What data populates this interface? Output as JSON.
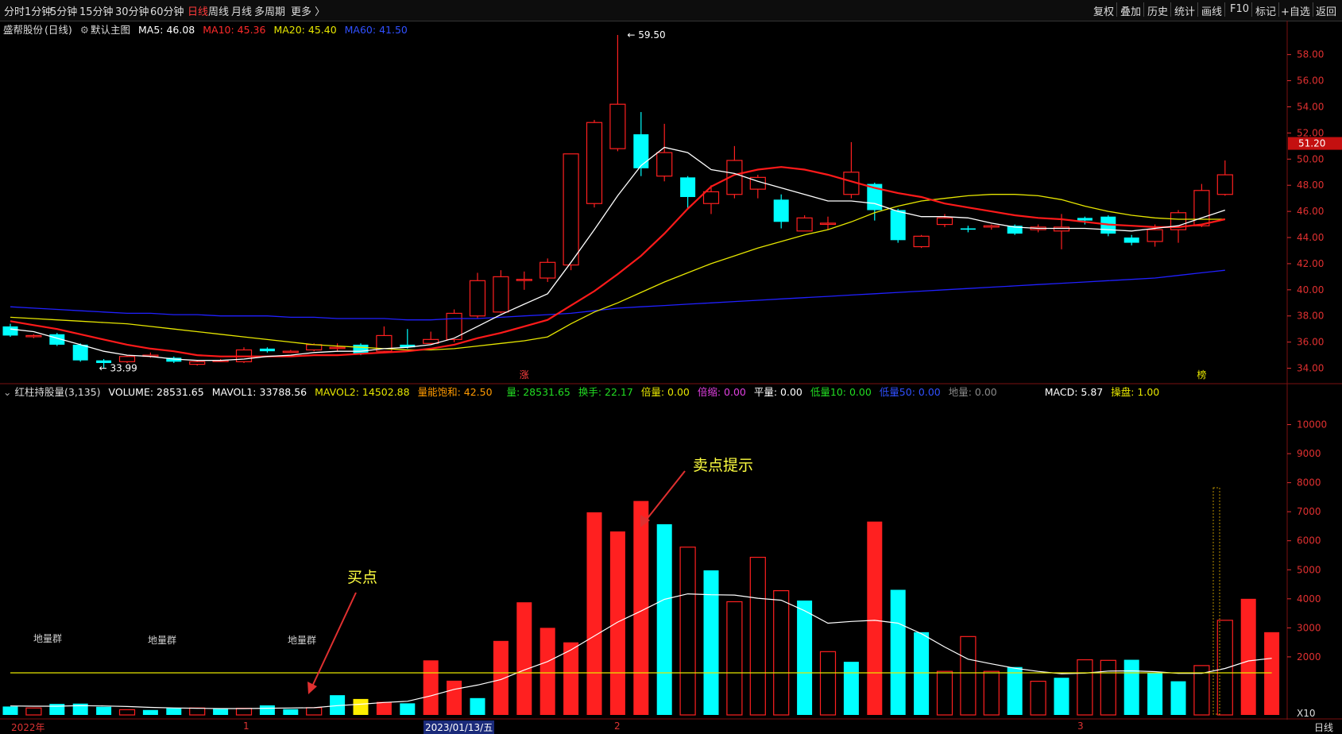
{
  "toolbar": {
    "left_tabs": [
      "分时",
      "1分钟",
      "5分钟",
      "15分钟",
      "30分钟",
      "60分钟",
      "日线",
      "周线",
      "月线",
      "多周期",
      "更多 〉"
    ],
    "active_tab": "日线",
    "right_buttons": [
      "复权",
      "叠加",
      "历史",
      "统计",
      "画线",
      "F10",
      "标记",
      "+自选",
      "返回"
    ]
  },
  "main_legend": {
    "stock": "盛帮股份",
    "period": "(日线)",
    "main_chart": "默认主图",
    "ma5": "MA5: 46.08",
    "ma10": "MA10: 45.36",
    "ma20": "MA20: 45.40",
    "ma60": "MA60: 41.50"
  },
  "volume_legend": {
    "name": "红柱持股量(3,135)",
    "volume": "VOLUME: 28531.65",
    "mavol1": "MAVOL1: 33788.56",
    "mavol2": "MAVOL2: 14502.88",
    "satur": "量能饱和: 42.50",
    "liang": "量: 28531.65",
    "huanshou": "换手: 22.17",
    "beiliang": "倍量: 0.00",
    "beisuo": "倍缩: 0.00",
    "pingliang": "平量: 0.00",
    "diliang10": "低量10: 0.00",
    "diliang50": "低量50: 0.00",
    "diliang": "地量: 0.00",
    "macd": "MACD: 5.87",
    "caopan": "操盘: 1.00"
  },
  "colors": {
    "up": "#ff2020",
    "down": "#00ffff",
    "ma5": "#ffffff",
    "ma10": "#ff1a1a",
    "ma20": "#e6e600",
    "ma60": "#2020ff",
    "axis": "#e03030",
    "annotation": "#ffff40"
  },
  "annotations": {
    "high": "59.50",
    "low": "33.99",
    "buy": "买点",
    "sell": "卖点提示",
    "zhang": "涨",
    "bang": "榜",
    "diliangqun": "地量群",
    "x10": "X10",
    "current_price": "51.20"
  },
  "bottom": {
    "dates": [
      "2022年",
      "1",
      "2023/01/13/五",
      "2",
      "3"
    ],
    "period": "日线"
  },
  "chart_data": [
    {
      "type": "candlestick",
      "title": "盛帮股份 (日线)",
      "ylim": [
        33.0,
        59.5
      ],
      "yticks": [
        34,
        36,
        38,
        40,
        42,
        44,
        46,
        48,
        50,
        52,
        54,
        56,
        58
      ],
      "candles": [
        {
          "o": 37.2,
          "h": 37.4,
          "l": 36.4,
          "c": 36.5
        },
        {
          "o": 36.5,
          "h": 36.6,
          "l": 36.3,
          "c": 36.5
        },
        {
          "o": 36.6,
          "h": 36.7,
          "l": 35.7,
          "c": 35.8
        },
        {
          "o": 35.8,
          "h": 35.9,
          "l": 34.5,
          "c": 34.6
        },
        {
          "o": 34.6,
          "h": 34.7,
          "l": 33.99,
          "c": 34.4
        },
        {
          "o": 34.5,
          "h": 35.0,
          "l": 34.4,
          "c": 34.9
        },
        {
          "o": 35.0,
          "h": 35.2,
          "l": 34.8,
          "c": 35.0
        },
        {
          "o": 34.8,
          "h": 34.9,
          "l": 34.4,
          "c": 34.5
        },
        {
          "o": 34.3,
          "h": 34.6,
          "l": 34.2,
          "c": 34.5
        },
        {
          "o": 34.6,
          "h": 34.7,
          "l": 34.5,
          "c": 34.6
        },
        {
          "o": 34.5,
          "h": 35.6,
          "l": 34.4,
          "c": 35.4
        },
        {
          "o": 35.5,
          "h": 35.6,
          "l": 35.2,
          "c": 35.3
        },
        {
          "o": 35.3,
          "h": 35.4,
          "l": 35.2,
          "c": 35.3
        },
        {
          "o": 35.4,
          "h": 35.9,
          "l": 35.3,
          "c": 35.8
        },
        {
          "o": 35.6,
          "h": 35.9,
          "l": 35.3,
          "c": 35.6
        },
        {
          "o": 35.8,
          "h": 35.9,
          "l": 35.0,
          "c": 35.1
        },
        {
          "o": 35.3,
          "h": 37.2,
          "l": 35.2,
          "c": 36.5
        },
        {
          "o": 35.8,
          "h": 37.0,
          "l": 35.5,
          "c": 35.6
        },
        {
          "o": 35.9,
          "h": 36.8,
          "l": 35.8,
          "c": 36.2
        },
        {
          "o": 36.2,
          "h": 38.5,
          "l": 36.0,
          "c": 38.2
        },
        {
          "o": 38.0,
          "h": 41.3,
          "l": 37.8,
          "c": 40.7
        },
        {
          "o": 38.3,
          "h": 41.5,
          "l": 38.2,
          "c": 41.0
        },
        {
          "o": 40.8,
          "h": 41.4,
          "l": 40.0,
          "c": 40.8
        },
        {
          "o": 40.9,
          "h": 42.4,
          "l": 40.6,
          "c": 42.1
        },
        {
          "o": 41.9,
          "h": 50.4,
          "l": 41.5,
          "c": 50.4
        },
        {
          "o": 46.6,
          "h": 53.0,
          "l": 46.3,
          "c": 52.8
        },
        {
          "o": 50.8,
          "h": 59.5,
          "l": 50.6,
          "c": 54.2
        },
        {
          "o": 51.9,
          "h": 53.6,
          "l": 48.7,
          "c": 49.3
        },
        {
          "o": 48.7,
          "h": 52.7,
          "l": 48.3,
          "c": 50.5
        },
        {
          "o": 48.6,
          "h": 48.7,
          "l": 46.2,
          "c": 47.1
        },
        {
          "o": 46.6,
          "h": 48.0,
          "l": 45.8,
          "c": 47.5
        },
        {
          "o": 47.3,
          "h": 51.0,
          "l": 47.0,
          "c": 49.9
        },
        {
          "o": 47.7,
          "h": 48.8,
          "l": 47.0,
          "c": 48.6
        },
        {
          "o": 46.9,
          "h": 47.3,
          "l": 44.7,
          "c": 45.2
        },
        {
          "o": 44.5,
          "h": 45.7,
          "l": 44.5,
          "c": 45.5
        },
        {
          "o": 45.1,
          "h": 45.6,
          "l": 44.6,
          "c": 45.1
        },
        {
          "o": 47.3,
          "h": 51.3,
          "l": 47.0,
          "c": 49.0
        },
        {
          "o": 48.1,
          "h": 48.2,
          "l": 45.3,
          "c": 46.1
        },
        {
          "o": 46.1,
          "h": 46.2,
          "l": 43.6,
          "c": 43.8
        },
        {
          "o": 43.3,
          "h": 44.2,
          "l": 43.2,
          "c": 44.1
        },
        {
          "o": 45.0,
          "h": 45.8,
          "l": 44.8,
          "c": 45.5
        },
        {
          "o": 44.7,
          "h": 44.9,
          "l": 44.4,
          "c": 44.6
        },
        {
          "o": 44.8,
          "h": 45.0,
          "l": 44.6,
          "c": 44.9
        },
        {
          "o": 44.9,
          "h": 45.0,
          "l": 44.2,
          "c": 44.3
        },
        {
          "o": 44.6,
          "h": 45.0,
          "l": 44.4,
          "c": 44.8
        },
        {
          "o": 44.5,
          "h": 45.8,
          "l": 43.1,
          "c": 44.8
        },
        {
          "o": 45.5,
          "h": 45.6,
          "l": 45.0,
          "c": 45.3
        },
        {
          "o": 45.6,
          "h": 45.7,
          "l": 44.1,
          "c": 44.3
        },
        {
          "o": 44.0,
          "h": 44.2,
          "l": 43.4,
          "c": 43.6
        },
        {
          "o": 43.7,
          "h": 45.0,
          "l": 43.3,
          "c": 44.6
        },
        {
          "o": 44.6,
          "h": 46.1,
          "l": 43.6,
          "c": 45.9
        },
        {
          "o": 44.9,
          "h": 48.1,
          "l": 44.8,
          "c": 47.6
        },
        {
          "o": 47.3,
          "h": 49.9,
          "l": 47.2,
          "c": 48.8
        }
      ],
      "ma5": [
        37.0,
        36.8,
        36.3,
        35.8,
        35.3,
        35.0,
        34.9,
        34.7,
        34.6,
        34.6,
        34.7,
        34.9,
        35.0,
        35.2,
        35.3,
        35.3,
        35.5,
        35.6,
        35.8,
        36.3,
        37.2,
        38.1,
        38.9,
        39.7,
        42.1,
        44.6,
        47.2,
        49.5,
        50.9,
        50.5,
        49.2,
        48.9,
        48.3,
        47.8,
        47.3,
        46.8,
        46.8,
        46.6,
        46.0,
        45.6,
        45.6,
        45.5,
        45.1,
        44.8,
        44.7,
        44.7,
        44.7,
        44.6,
        44.5,
        44.7,
        44.9,
        45.5,
        46.1
      ],
      "ma10": [
        37.6,
        37.3,
        37.0,
        36.6,
        36.2,
        35.8,
        35.5,
        35.3,
        35.0,
        34.9,
        34.9,
        34.9,
        34.9,
        35.0,
        35.0,
        35.1,
        35.2,
        35.3,
        35.5,
        35.8,
        36.3,
        36.7,
        37.2,
        37.7,
        38.8,
        39.9,
        41.2,
        42.6,
        44.3,
        46.2,
        47.9,
        48.8,
        49.2,
        49.4,
        49.2,
        48.8,
        48.3,
        47.8,
        47.4,
        47.1,
        46.6,
        46.3,
        46.0,
        45.7,
        45.5,
        45.4,
        45.2,
        45.0,
        44.9,
        44.8,
        44.8,
        45.0,
        45.4
      ],
      "ma20": [
        37.9,
        37.8,
        37.7,
        37.6,
        37.5,
        37.4,
        37.2,
        37.0,
        36.8,
        36.6,
        36.4,
        36.2,
        36.0,
        35.8,
        35.7,
        35.6,
        35.5,
        35.4,
        35.4,
        35.5,
        35.7,
        35.9,
        36.1,
        36.4,
        37.4,
        38.3,
        39.0,
        39.8,
        40.6,
        41.3,
        42.0,
        42.6,
        43.2,
        43.7,
        44.2,
        44.6,
        45.2,
        45.9,
        46.4,
        46.8,
        47.0,
        47.2,
        47.3,
        47.3,
        47.2,
        46.9,
        46.4,
        46.0,
        45.7,
        45.5,
        45.4,
        45.4,
        45.4
      ],
      "ma60": [
        38.7,
        38.6,
        38.5,
        38.4,
        38.3,
        38.2,
        38.2,
        38.1,
        38.1,
        38.0,
        38.0,
        38.0,
        37.9,
        37.9,
        37.8,
        37.8,
        37.8,
        37.7,
        37.7,
        37.8,
        37.8,
        37.9,
        38.0,
        38.1,
        38.2,
        38.4,
        38.6,
        38.7,
        38.8,
        38.9,
        39.0,
        39.1,
        39.2,
        39.3,
        39.4,
        39.5,
        39.6,
        39.7,
        39.8,
        39.9,
        40.0,
        40.1,
        40.2,
        40.3,
        40.4,
        40.5,
        40.6,
        40.7,
        40.8,
        40.9,
        41.1,
        41.3,
        41.5
      ]
    },
    {
      "type": "bar",
      "title": "红柱持股量(3,135)",
      "ylim": [
        0,
        11000
      ],
      "yticks": [
        2000,
        3000,
        4000,
        5000,
        6000,
        7000,
        8000,
        9000,
        10000
      ],
      "volume": [
        290,
        240,
        380,
        390,
        280,
        180,
        170,
        230,
        240,
        220,
        230,
        330,
        200,
        250,
        680,
        550,
        450,
        400,
        1880,
        1180,
        580,
        2550,
        3880,
        3000,
        2500,
        6980,
        6320,
        7370,
        6570,
        5780,
        4980,
        3900,
        5430,
        4280,
        3940,
        2180,
        1830,
        6660,
        4310,
        2850,
        1500,
        2700,
        1500,
        1650,
        1160,
        1280,
        1900,
        1880,
        1900,
        1450,
        1160,
        1700,
        3260,
        4000,
        2850
      ],
      "vol_type": [
        "d",
        "u",
        "d",
        "d",
        "d",
        "u",
        "d",
        "d",
        "u",
        "d",
        "u",
        "d",
        "d",
        "u",
        "d",
        "y",
        "r",
        "d",
        "r",
        "r",
        "d",
        "r",
        "r",
        "r",
        "r",
        "r",
        "r",
        "r",
        "d",
        "u",
        "d",
        "u",
        "u",
        "u",
        "d",
        "u",
        "d",
        "r",
        "d",
        "d",
        "u",
        "u",
        "u",
        "d",
        "u",
        "d",
        "u",
        "u",
        "d",
        "d",
        "d",
        "u",
        "u",
        "r",
        "r"
      ],
      "mavol1": [
        310,
        300,
        300,
        320,
        310,
        290,
        260,
        240,
        230,
        220,
        220,
        230,
        240,
        250,
        320,
        370,
        430,
        470,
        660,
        880,
        1030,
        1220,
        1550,
        1840,
        2240,
        2720,
        3200,
        3580,
        3980,
        4170,
        4140,
        4130,
        4020,
        3950,
        3590,
        3160,
        3220,
        3260,
        3160,
        2800,
        2340,
        1920,
        1760,
        1610,
        1500,
        1420,
        1440,
        1510,
        1520,
        1490,
        1430,
        1430,
        1600,
        1860,
        1950
      ]
    }
  ]
}
